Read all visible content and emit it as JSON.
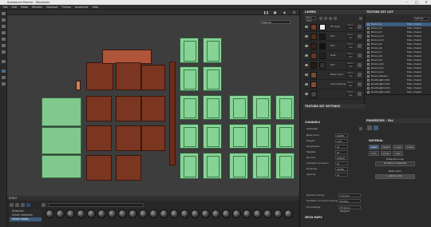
{
  "app": {
    "title": "Substance Painter - Blockouts"
  },
  "menu": [
    "File",
    "Edit",
    "Mode",
    "Window",
    "Viewport",
    "Python",
    "JavaScript",
    "Help"
  ],
  "viewport": {
    "display_mode": "Material"
  },
  "shelf": {
    "title": "SHELF",
    "categories": [
      "Materials",
      "Smart materials",
      "Smart masks"
    ],
    "selected_category": "Smart masks"
  },
  "layers": {
    "title": "LAYERS",
    "blend_label": "Base Color",
    "opacity_label": "Opacity",
    "items": [
      {
        "name": "Fill layer",
        "mode": "Norm",
        "mode_value": "100",
        "thumb": "#7a3a22"
      },
      {
        "name": "Dirt",
        "mode": "Norm",
        "mode_value": "100",
        "thumb": "#5a2a18"
      },
      {
        "name": "Dirt",
        "mode": "Norm",
        "mode_value": "100",
        "thumb": "#3a2015"
      },
      {
        "name": "Rust",
        "mode": "Norm",
        "mode_value": "100",
        "thumb": "#6b3521"
      },
      {
        "name": "Dirt",
        "mode": "Norm",
        "mode_value": "100",
        "thumb": "#2c1a10"
      },
      {
        "name": "Base Color",
        "mode": "Norm",
        "mode_value": "100",
        "thumb": "#7a4a2a"
      },
      {
        "name": "wood exterior",
        "mode": "Norm",
        "mode_value": "100",
        "thumb": "#8b4a2a"
      },
      {
        "name": "",
        "mode": "Norm",
        "mode_value": "100",
        "thumb": "#444"
      }
    ]
  },
  "texture_set_list": {
    "title": "TEXTURE SET LIST",
    "settings_label": "Settings",
    "items": [
      {
        "name": "Balcony1",
        "shader": "Main shader"
      },
      {
        "name": "Balcony2",
        "shader": "Main shader"
      },
      {
        "name": "Balcony3",
        "shader": "Main shader"
      },
      {
        "name": "Balcony13",
        "shader": "Main shader"
      },
      {
        "name": "Balcony14",
        "shader": "Main shader"
      },
      {
        "name": "Balcony5",
        "shader": "Main shader"
      },
      {
        "name": "Balcony6",
        "shader": "Main shader"
      },
      {
        "name": "Balcony7",
        "shader": "Main shader"
      },
      {
        "name": "Balcony8",
        "shader": "Main shader"
      },
      {
        "name": "Balcony9",
        "shader": "Main shader"
      },
      {
        "name": "Balcony10",
        "shader": "Main shader"
      },
      {
        "name": "Balcony11",
        "shader": "Main shader"
      },
      {
        "name": "Balcony12",
        "shader": "Main shader"
      },
      {
        "name": "BalconyBase1",
        "shader": "Main shader"
      },
      {
        "name": "BuildingBrick01",
        "shader": "Main shader"
      },
      {
        "name": "BuildingBrick02",
        "shader": "Main shader"
      },
      {
        "name": "BuildingBrick03",
        "shader": "Main shader"
      },
      {
        "name": "BuildingBrick04",
        "shader": "Main shader"
      },
      {
        "name": "BuildingBrick05",
        "shader": "Main shader"
      }
    ]
  },
  "texture_set_settings": {
    "title": "TEXTURE SET SETTINGS",
    "channels_title": "CHANNELS",
    "channels_label": "Channels",
    "channels": [
      {
        "name": "Base Color",
        "format": "sRGB8",
        "extra": "L8"
      },
      {
        "name": "Height",
        "format": "L16F",
        "extra": "L8"
      },
      {
        "name": "Roughness",
        "format": "L8",
        "extra": "L8"
      },
      {
        "name": "Metallic",
        "format": "L8",
        "extra": "L8"
      },
      {
        "name": "Normal",
        "format": "RGB16F",
        "extra": "L8"
      },
      {
        "name": "Ambient occlusion",
        "format": "L8",
        "extra": "L8"
      },
      {
        "name": "Emissive",
        "format": "sRGB8",
        "extra": "L8"
      },
      {
        "name": "Opacity",
        "format": "L8",
        "extra": "L8"
      }
    ],
    "normal_mixing_label": "Normal mixing",
    "normal_mixing_value": "Combine",
    "ao_mixing_label": "Ambient occlusion mixing",
    "ao_mixing_value": "Multiply",
    "uv_padding_label": "UV padding",
    "uv_padding_value": "3D Space Neighbor",
    "mesh_maps_title": "MESH MAPS"
  },
  "properties": {
    "title": "PROPERTIES - FILL",
    "material_title": "MATERIAL",
    "toggles": [
      "color",
      "height",
      "rough",
      "metal",
      "nrm",
      "emiss",
      "opac"
    ],
    "material_mode_label": "Material mode",
    "material_mode_value": "No Resource Selected",
    "base_color_label": "Base Color",
    "base_color_value": "uniform color"
  },
  "colors": {
    "accent": "#3b5c7e",
    "mesh_green": "#86d396",
    "wood": "#7a3621"
  }
}
